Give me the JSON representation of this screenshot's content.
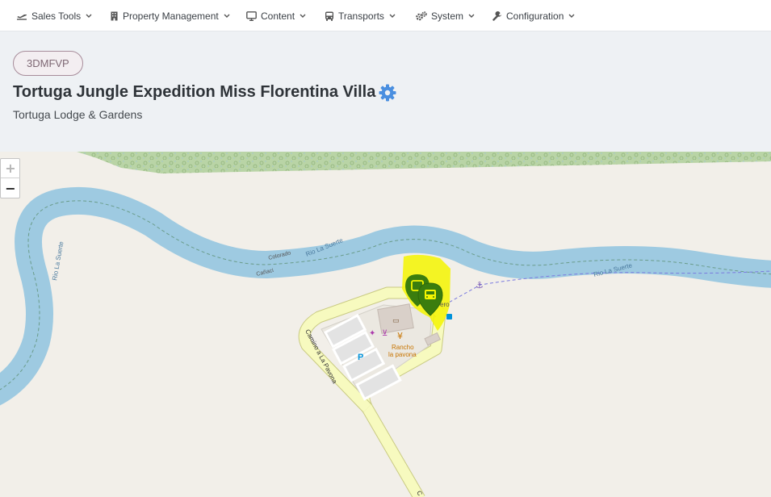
{
  "nav": {
    "items": [
      {
        "label": "Sales Tools",
        "icon": "plane-icon"
      },
      {
        "label": "Property Management",
        "icon": "building-icon"
      },
      {
        "label": "Content",
        "icon": "monitor-icon"
      },
      {
        "label": "Transports",
        "icon": "bus-icon"
      },
      {
        "label": "System",
        "icon": "gears-icon"
      },
      {
        "label": "Configuration",
        "icon": "wrench-icon"
      }
    ]
  },
  "header": {
    "code": "3DMFVP",
    "title": "Tortuga Jungle Expedition Miss Florentina Villa",
    "subtitle": "Tortuga Lodge & Gardens"
  },
  "map": {
    "zoom_in": "+",
    "zoom_out": "−",
    "labels": {
      "river_left": "Rio La Suerte",
      "river_mid": "Rio La Suerte",
      "river_right": "Rio La Suerte",
      "colorado": "Colorado",
      "caraci": "Cañaci",
      "road": "Camino a La Pavona",
      "restaurant_1": "Rancho",
      "restaurant_2": "la pavona",
      "partial": "ero",
      "road_bottom": "C",
      "parking": "P"
    }
  },
  "colors": {
    "accent": "#4a8fe0",
    "river": "#9ecae1",
    "forest": "#add19e",
    "road": "#f7fabf",
    "highlight": "#f5f500",
    "marker": "#3a7d0e"
  }
}
